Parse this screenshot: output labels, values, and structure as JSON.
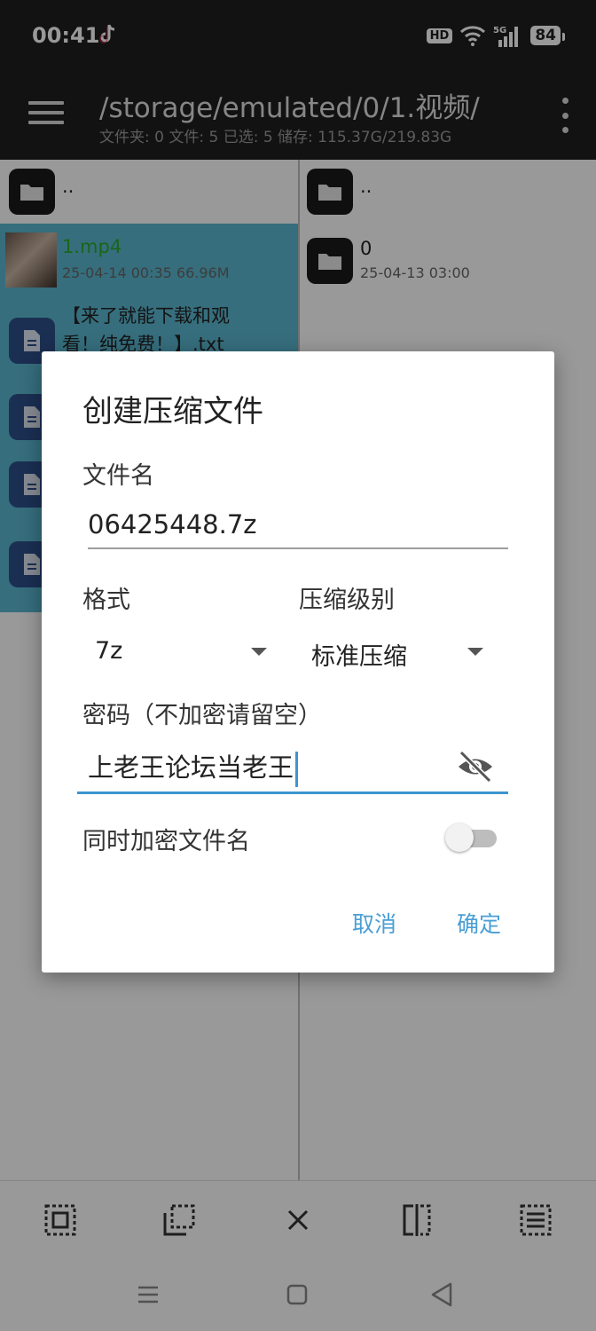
{
  "status_bar": {
    "time": "00:41",
    "hd": "HD",
    "network": "5G",
    "battery": "84"
  },
  "toolbar": {
    "path": "/storage/emulated/0/1.视频/",
    "subtitle": "文件夹: 0  文件: 5  已选: 5  储存: 115.37G/219.83G"
  },
  "left_pane": {
    "items": [
      {
        "name": "..",
        "meta": ""
      },
      {
        "name": "1.mp4",
        "meta": "25-04-14 00:35  66.96M"
      },
      {
        "name": "【来了就能下载和观看！纯免费！】.txt",
        "line1": "【来了就能下载和观",
        "line2": "看！纯免费！】.txt"
      }
    ]
  },
  "right_pane": {
    "items": [
      {
        "name": "..",
        "meta": ""
      },
      {
        "name": "0",
        "meta": "25-04-13 03:00"
      }
    ]
  },
  "dialog": {
    "title": "创建压缩文件",
    "filename_label": "文件名",
    "filename_value": "06425448.7z",
    "format_label": "格式",
    "format_value": "7z",
    "level_label": "压缩级别",
    "level_value": "标准压缩",
    "password_label": "密码（不加密请留空）",
    "password_value": "上老王论坛当老王",
    "encrypt_names_label": "同时加密文件名",
    "encrypt_names_on": false,
    "cancel_label": "取消",
    "ok_label": "确定",
    "accent_color": "#3d95cf"
  }
}
